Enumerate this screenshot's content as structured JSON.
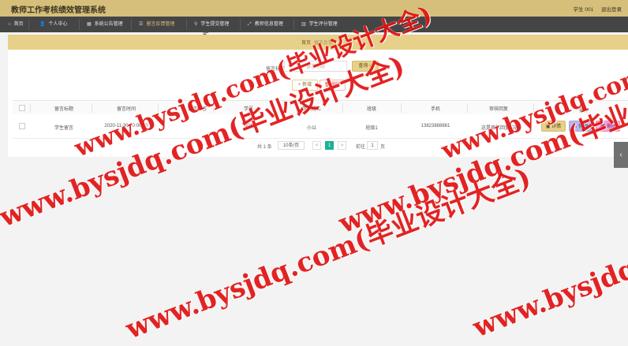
{
  "header": {
    "title": "教师工作考核绩效管理系统",
    "user": "学生 001",
    "logout": "退出登录"
  },
  "nav": [
    {
      "label": "首页",
      "icon": "home-icon",
      "glyph": "⌂"
    },
    {
      "label": "个人中心",
      "icon": "user-icon",
      "glyph": "👤"
    },
    {
      "label": "系统公告管理",
      "icon": "grid-icon",
      "glyph": "▦"
    },
    {
      "label": "留言反馈管理",
      "icon": "list-icon",
      "glyph": "☰"
    },
    {
      "label": "学生提交管理",
      "icon": "pin-icon",
      "glyph": "⚲"
    },
    {
      "label": "教师信息管理",
      "icon": "expand-icon",
      "glyph": "⤢"
    },
    {
      "label": "学生评分管理",
      "icon": "chart-icon",
      "glyph": "▥"
    }
  ],
  "banner": {
    "crumb": "首页",
    "sub": "留言反馈"
  },
  "search": {
    "label": "留言标题",
    "placeholder": "留言标题",
    "button": "查询"
  },
  "actions": {
    "add": "+ 新增",
    "delete": "🗑 删除"
  },
  "table": {
    "headers": [
      "留言标题",
      "留言时间",
      "留言内容",
      "学号",
      "学生姓名",
      "班级",
      "手机",
      "审核回复",
      "操作"
    ],
    "rows": [
      {
        "title": "学生留言",
        "time": "2020-11-30 00:00:00",
        "content": "",
        "student_id": "001",
        "name": "小以",
        "class": "班级1",
        "phone": "13823888881",
        "reply": "这是审核回复内容"
      }
    ],
    "row_buttons": {
      "detail": "详情",
      "edit": "修改",
      "remove": "删除"
    }
  },
  "pagination": {
    "total": "共 1 条",
    "page_size": "10条/页",
    "prev": "<",
    "current": "1",
    "next": ">",
    "goto_label": "前往",
    "goto_value": "1",
    "page_unit": "页"
  },
  "watermark": "www.bysjdq.com(毕业设计大全)",
  "colors": {
    "header": "#d5bf7a",
    "navbar": "#454545",
    "accent": "#e6d08a",
    "watermark": "#e11212",
    "page_current": "#1bb394"
  }
}
